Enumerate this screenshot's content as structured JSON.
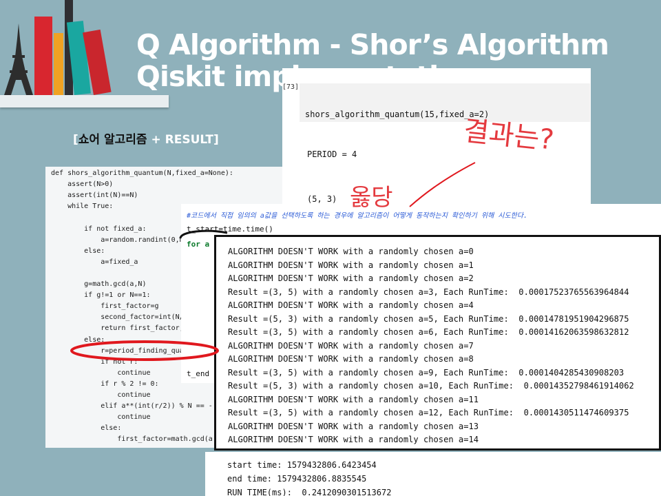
{
  "slide": {
    "title_line1": "Q Algorithm  - Shor’s  Algorithm",
    "title_line2": "Qiskit implementation",
    "subtitle_korean": "쇼어 알고리즘",
    "subtitle_open_bracket": "[",
    "subtitle_rest": " + RESULT]"
  },
  "left_code": {
    "lines": [
      "def shors_algorithm_quantum(N,fixed_a=None):",
      "    assert(N>0)",
      "    assert(int(N)==N)",
      "    while True:",
      "",
      "        if not fixed_a:",
      "            a=random.randint(0,N",
      "        else:",
      "            a=fixed_a",
      "",
      "        g=math.gcd(a,N)",
      "        if g!=1 or N==1:",
      "            first_factor=g",
      "            second_factor=int(N/",
      "            return first_factor,",
      "        else:",
      "            r=period_finding_quan",
      "            if not r:",
      "                continue",
      "            if r % 2 != 0:",
      "                continue",
      "            elif a**(int(r/2)) % N == -",
      "                continue",
      "            else:",
      "                first_factor=math.gcd(a"
    ]
  },
  "top_cell": {
    "prompt": "[73]:",
    "code": "shors_algorithm_quantum(15,fixed_a=2)",
    "period": "PERIOD =  4",
    "tuple": "(5, 3)",
    "handwritten_question": "결과는?",
    "handwritten_answer": "옳당"
  },
  "mid_cell": {
    "comment": "#코드에서 직접 임의의 a값을 선택하도록 하는 경우에 알고리즘이 어떻게 동작하는지 확인하기 위해 시도한다.",
    "line1": "t_start=time.time()",
    "line2": "for a",
    "line3": "t_end"
  },
  "output": {
    "lines": [
      "ALGORITHM DOESN'T WORK with a randomly chosen a=0",
      "ALGORITHM DOESN'T WORK with a randomly chosen a=1",
      "ALGORITHM DOESN'T WORK with a randomly chosen a=2",
      "Result =(3, 5) with a randomly chosen a=3, Each RunTime:  0.00017523765563964844",
      "ALGORITHM DOESN'T WORK with a randomly chosen a=4",
      "Result =(5, 3) with a randomly chosen a=5, Each RunTime:  0.0001478195190429687​5",
      "Result =(3, 5) with a randomly chosen a=6, Each RunTime:  0.00014162063598632812",
      "ALGORITHM DOESN'T WORK with a randomly chosen a=7",
      "ALGORITHM DOESN'T WORK with a randomly chosen a=8",
      "Result =(3, 5) with a randomly chosen a=9, Each RunTime:  0.0001404285430908203",
      "Result =(5, 3) with a randomly chosen a=10, Each RunTime:  0.00014352798461914062",
      "ALGORITHM DOESN'T WORK with a randomly chosen a=11",
      "Result =(3, 5) with a randomly chosen a=12, Each RunTime:  0.0001430511474609375",
      "ALGORITHM DOESN'T WORK with a randomly chosen a=13",
      "ALGORITHM DOESN'T WORK with a randomly chosen a=14"
    ]
  },
  "timing": {
    "start": "start time: 1579432806.6423454",
    "end": "end time: 1579432806.8835545",
    "run": "RUN TIME(ms):  0.2412090301513672"
  }
}
